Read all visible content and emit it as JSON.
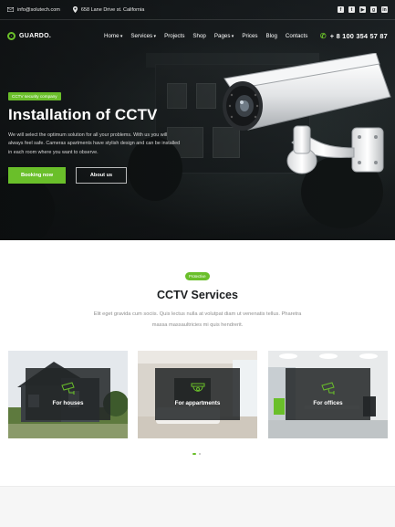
{
  "topbar": {
    "email": "info@solutech.com",
    "address": "658 Lane Drive st. California",
    "socials": [
      "facebook-icon",
      "twitter-icon",
      "youtube-icon",
      "github-icon",
      "linkedin-icon"
    ]
  },
  "navbar": {
    "logo": "GUARDO.",
    "items": [
      {
        "label": "Home",
        "dropdown": true
      },
      {
        "label": "Services",
        "dropdown": true
      },
      {
        "label": "Projects",
        "dropdown": false
      },
      {
        "label": "Shop",
        "dropdown": false
      },
      {
        "label": "Pages",
        "dropdown": true
      },
      {
        "label": "Prices",
        "dropdown": false
      },
      {
        "label": "Blog",
        "dropdown": false
      },
      {
        "label": "Contacts",
        "dropdown": false
      }
    ],
    "phone": "+ 8 100 354 57 87"
  },
  "hero": {
    "badge": "CCTV security company",
    "title": "Installation of CCTV",
    "description": "We will select the optimum solution for all your problems. With us you will always feel safe. Cameras apartments have stylish design and can be installed in each room where you want to observe.",
    "primary_button": "Booking now",
    "secondary_button": "About us"
  },
  "services": {
    "tag": "Protective",
    "title": "CCTV Services",
    "description": "Elit eget gravida cum sociis. Quis lectus nulla at volutpat diam ut venenatis tellus. Pharetra massa massaultricies mi quis hendrerit.",
    "cards": [
      {
        "label": "For houses",
        "icon": "cctv-camera-icon"
      },
      {
        "label": "For appartments",
        "icon": "dome-camera-icon"
      },
      {
        "label": "For offices",
        "icon": "cctv-camera-icon"
      }
    ],
    "pagination": {
      "active": 1,
      "total": 2
    }
  },
  "colors": {
    "accent": "#6abf2a",
    "dark": "#1c2124"
  }
}
